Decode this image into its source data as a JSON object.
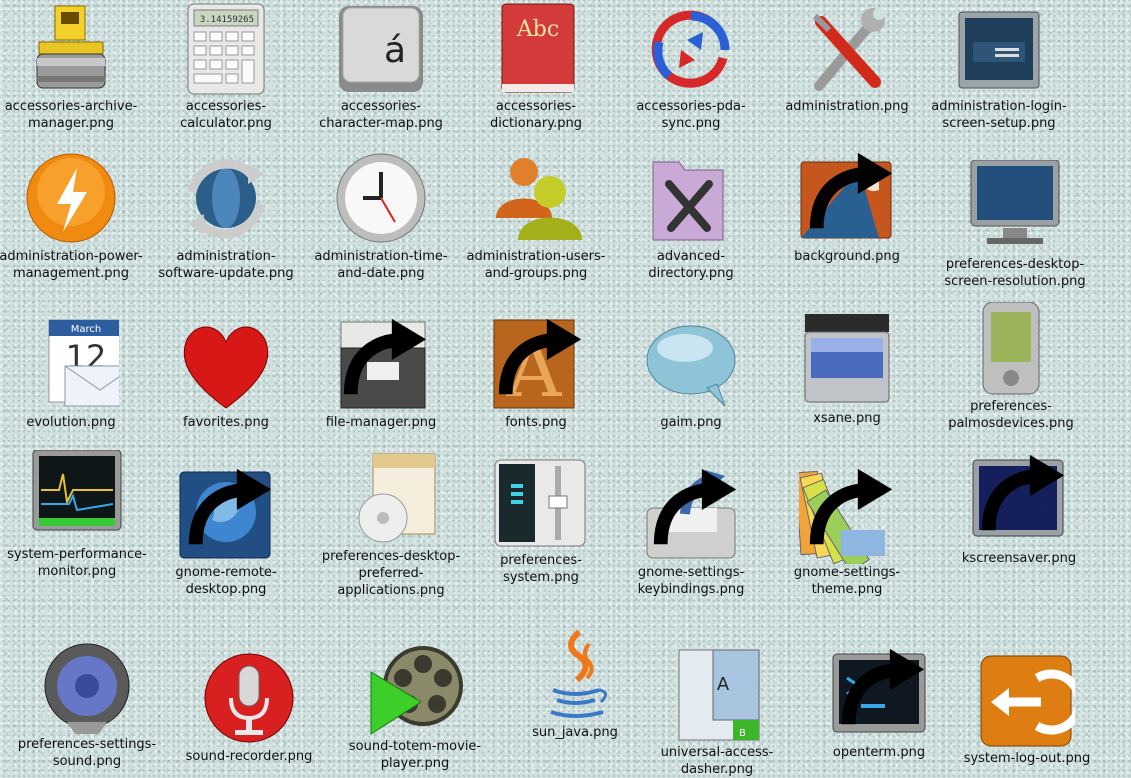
{
  "icons": [
    {
      "label": "accessories-archive-manager.png",
      "icon": "archive-manager-icon"
    },
    {
      "label": "accessories-calculator.png",
      "icon": "calculator-icon",
      "display": "3.14159265"
    },
    {
      "label": "accessories-character-map.png",
      "icon": "character-map-icon",
      "glyph": "á"
    },
    {
      "label": "accessories-dictionary.png",
      "icon": "dictionary-icon",
      "glyph": "Abc"
    },
    {
      "label": "accessories-pda-sync.png",
      "icon": "pda-sync-icon"
    },
    {
      "label": "administration.png",
      "icon": "administration-tools-icon"
    },
    {
      "label": "administration-login-screen-setup.png",
      "icon": "login-screen-icon"
    },
    {
      "label": "administration-power-management.png",
      "icon": "power-management-icon"
    },
    {
      "label": "administration-software-update.png",
      "icon": "software-update-icon"
    },
    {
      "label": "administration-time-and-date.png",
      "icon": "clock-icon"
    },
    {
      "label": "administration-users-and-groups.png",
      "icon": "users-groups-icon"
    },
    {
      "label": "advanced-directory.png",
      "icon": "advanced-directory-icon"
    },
    {
      "label": "background.png",
      "icon": "background-icon",
      "link": true
    },
    {
      "label": "preferences-desktop-screen-resolution.png",
      "icon": "monitor-icon"
    },
    {
      "label": "evolution.png",
      "icon": "evolution-icon",
      "month": "March",
      "day": "12"
    },
    {
      "label": "favorites.png",
      "icon": "heart-icon"
    },
    {
      "label": "file-manager.png",
      "icon": "file-cabinet-icon",
      "link": true
    },
    {
      "label": "fonts.png",
      "icon": "fonts-icon",
      "glyph": "A",
      "link": true
    },
    {
      "label": "gaim.png",
      "icon": "chat-bubble-icon"
    },
    {
      "label": "xsane.png",
      "icon": "scanner-icon"
    },
    {
      "label": "preferences-palmosdevices.png",
      "icon": "palm-device-icon"
    },
    {
      "label": "system-performance-monitor.png",
      "icon": "performance-monitor-icon"
    },
    {
      "label": "gnome-remote-desktop.png",
      "icon": "remote-desktop-icon",
      "link": true
    },
    {
      "label": "preferences-desktop-preferred-applications.png",
      "icon": "preferred-applications-icon"
    },
    {
      "label": "preferences-system.png",
      "icon": "system-preferences-icon"
    },
    {
      "label": "gnome-settings-keybindings.png",
      "icon": "keybindings-icon",
      "link": true
    },
    {
      "label": "gnome-settings-theme.png",
      "icon": "theme-palette-icon",
      "link": true
    },
    {
      "label": "kscreensaver.png",
      "icon": "screensaver-icon",
      "link": true
    },
    {
      "label": "preferences-settings-sound.png",
      "icon": "speaker-icon"
    },
    {
      "label": "sound-recorder.png",
      "icon": "microphone-icon"
    },
    {
      "label": "sound-totem-movie-player.png",
      "icon": "movie-player-icon"
    },
    {
      "label": "sun_java.png",
      "icon": "java-cup-icon"
    },
    {
      "label": "universal-access-dasher.png",
      "icon": "dasher-icon",
      "glyph": "A",
      "glyph2": "B"
    },
    {
      "label": "openterm.png",
      "icon": "terminal-icon",
      "link": true
    },
    {
      "label": "system-log-out.png",
      "icon": "log-out-icon"
    }
  ]
}
